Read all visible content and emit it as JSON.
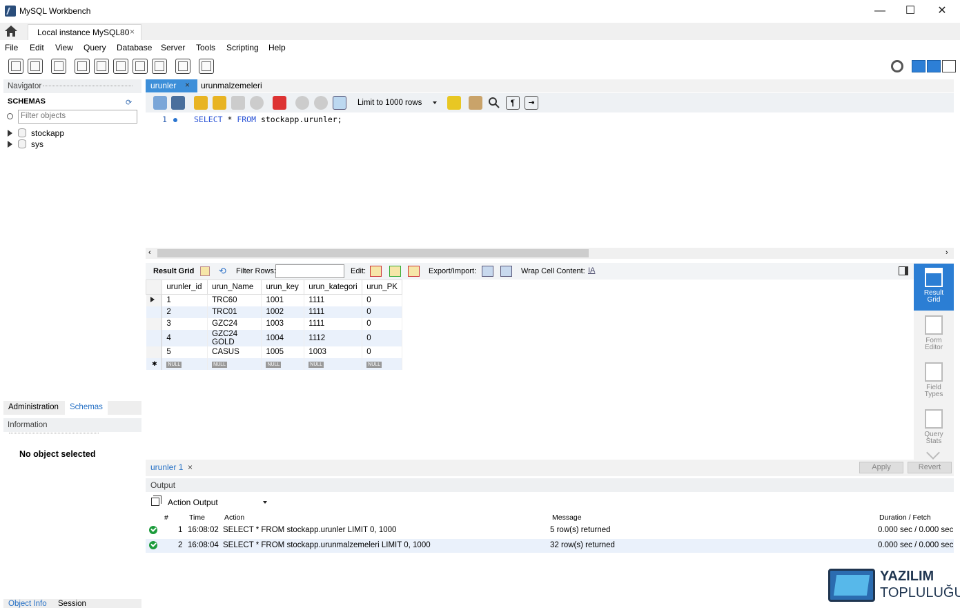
{
  "window": {
    "title": "MySQL Workbench",
    "minimize": "—",
    "maximize": "☐",
    "close": "✕"
  },
  "tabs": {
    "connection": "Local instance MySQL80",
    "close": "×"
  },
  "menu": [
    "File",
    "Edit",
    "View",
    "Query",
    "Database",
    "Server",
    "Tools",
    "Scripting",
    "Help"
  ],
  "navigator": {
    "header": "Navigator",
    "schemas_title": "SCHEMAS",
    "filter_placeholder": "Filter objects",
    "schemas": [
      "stockapp",
      "sys"
    ],
    "tabs": [
      "Administration",
      "Schemas"
    ],
    "info_header": "Information",
    "no_object": "No object selected",
    "bottom_tabs": [
      "Object Info",
      "Session"
    ]
  },
  "editor": {
    "tabs": [
      "urunler",
      "urunmalzemeleri"
    ],
    "limit": "Limit to 1000 rows",
    "line_no": "1",
    "code": {
      "kw1": "SELECT",
      "mid": " * ",
      "kw2": "FROM",
      "rest": " stockapp.urunler;"
    }
  },
  "results": {
    "toolbar": {
      "result_grid": "Result Grid",
      "filter_rows": "Filter Rows:",
      "edit": "Edit:",
      "export": "Export/Import:",
      "wrap": "Wrap Cell Content:"
    },
    "columns": [
      "urunler_id",
      "urun_Name",
      "urun_key",
      "urun_kategori",
      "urun_PK"
    ],
    "rows": [
      [
        "1",
        "TRC60",
        "1001",
        "1111",
        "0"
      ],
      [
        "2",
        "TRC01",
        "1002",
        "1111",
        "0"
      ],
      [
        "3",
        "GZC24",
        "1003",
        "1111",
        "0"
      ],
      [
        "4",
        "GZC24 GOLD",
        "1004",
        "1112",
        "0"
      ],
      [
        "5",
        "CASUS",
        "1005",
        "1003",
        "0"
      ]
    ],
    "null_label": "NULL",
    "result_tab": "urunler 1",
    "apply": "Apply",
    "revert": "Revert"
  },
  "side_panel": [
    {
      "line1": "Result",
      "line2": "Grid"
    },
    {
      "line1": "Form",
      "line2": "Editor"
    },
    {
      "line1": "Field",
      "line2": "Types"
    },
    {
      "line1": "Query",
      "line2": "Stats"
    }
  ],
  "output": {
    "header": "Output",
    "selector": "Action Output",
    "columns": {
      "num": "#",
      "time": "Time",
      "action": "Action",
      "message": "Message",
      "duration": "Duration / Fetch"
    },
    "rows": [
      {
        "num": "1",
        "time": "16:08:02",
        "action": "SELECT * FROM stockapp.urunler LIMIT 0, 1000",
        "message": "5 row(s) returned",
        "duration": "0.000 sec / 0.000 sec"
      },
      {
        "num": "2",
        "time": "16:08:04",
        "action": "SELECT * FROM stockapp.urunmalzemeleri LIMIT 0, 1000",
        "message": "32 row(s) returned",
        "duration": "0.000 sec / 0.000 sec"
      }
    ]
  },
  "watermark": {
    "line1": "YAZILIM",
    "line2": "TOPLULUĞU"
  }
}
